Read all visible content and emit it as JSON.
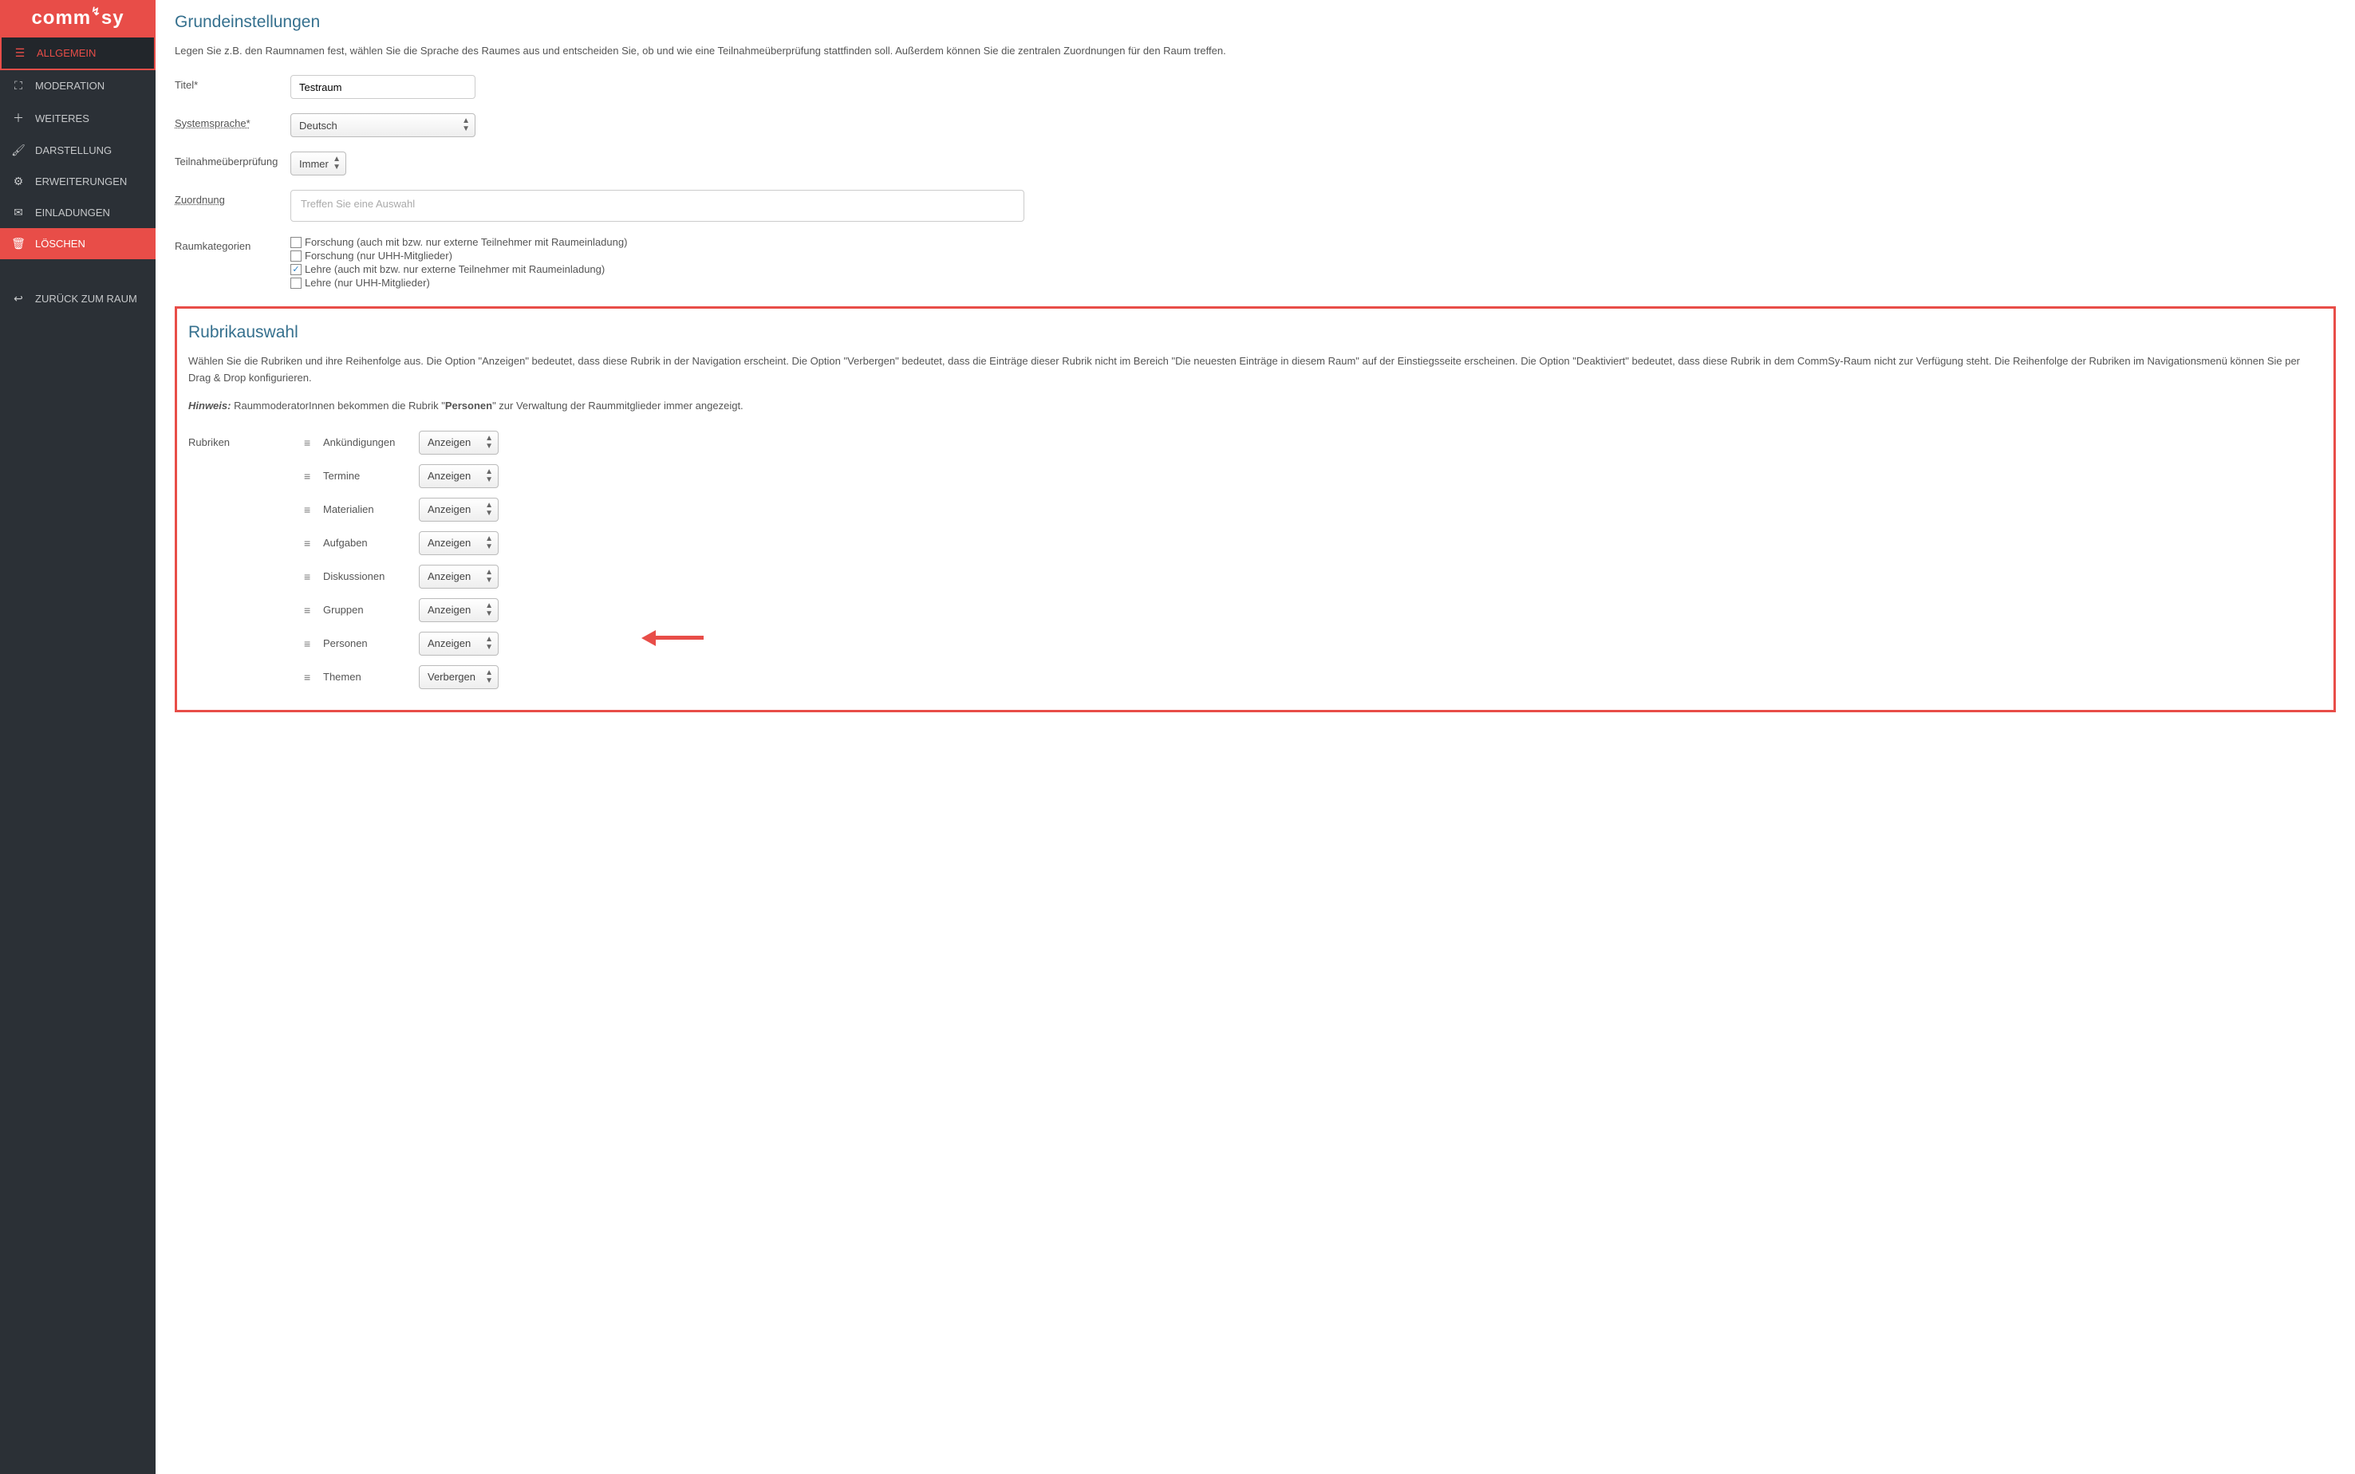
{
  "brand": "commsy",
  "sidebar": {
    "items": [
      {
        "label": "ALLGEMEIN",
        "icon": "server-icon",
        "active": true
      },
      {
        "label": "MODERATION",
        "icon": "sitemap-icon"
      },
      {
        "label": "WEITERES",
        "icon": "plus-icon"
      },
      {
        "label": "DARSTELLUNG",
        "icon": "brush-icon"
      },
      {
        "label": "ERWEITERUNGEN",
        "icon": "gears-icon"
      },
      {
        "label": "EINLADUNGEN",
        "icon": "envelope-icon"
      },
      {
        "label": "LÖSCHEN",
        "icon": "trash-icon",
        "delete": true
      }
    ],
    "back": {
      "label": "ZURÜCK ZUM RAUM",
      "icon": "reply-icon"
    }
  },
  "section1": {
    "title": "Grundeinstellungen",
    "description": "Legen Sie z.B. den Raumnamen fest, wählen Sie die Sprache des Raumes aus und entscheiden Sie, ob und wie eine Teilnahmeüberprüfung stattfinden soll. Außerdem können Sie die zentralen Zuordnungen für den Raum treffen.",
    "labels": {
      "title": "Titel*",
      "language": "Systemsprache*",
      "participation": "Teilnahmeüberprüfung",
      "assignment": "Zuordnung",
      "categories": "Raumkategorien"
    },
    "values": {
      "title": "Testraum",
      "language": "Deutsch",
      "participation": "Immer",
      "assignment_placeholder": "Treffen Sie eine Auswahl"
    },
    "categories": [
      {
        "label": "Forschung (auch mit bzw. nur externe Teilnehmer mit Raumeinladung)",
        "checked": false
      },
      {
        "label": "Forschung (nur UHH-Mitglieder)",
        "checked": false
      },
      {
        "label": "Lehre (auch mit bzw. nur externe Teilnehmer mit Raumeinladung)",
        "checked": true
      },
      {
        "label": "Lehre (nur UHH-Mitglieder)",
        "checked": false
      }
    ]
  },
  "section2": {
    "title": "Rubrikauswahl",
    "description": "Wählen Sie die Rubriken und ihre Reihenfolge aus. Die Option \"Anzeigen\" bedeutet, dass diese Rubrik in der Navigation erscheint. Die Option \"Verbergen\" bedeutet, dass die Einträge dieser Rubrik nicht im Bereich \"Die neuesten Einträge in diesem Raum\" auf der Einstiegsseite erscheinen. Die Option \"Deaktiviert\" bedeutet, dass diese Rubrik in dem CommSy-Raum nicht zur Verfügung steht. Die Reihenfolge der Rubriken im Navigationsmenü können Sie per Drag & Drop konfigurieren.",
    "hint_label": "Hinweis:",
    "hint_pre": " RaummoderatorInnen bekommen die Rubrik \"",
    "hint_bold": "Personen",
    "hint_post": "\" zur Verwaltung der Raummitglieder immer angezeigt.",
    "rubriken_label": "Rubriken",
    "rubriken": [
      {
        "name": "Ankündigungen",
        "value": "Anzeigen"
      },
      {
        "name": "Termine",
        "value": "Anzeigen"
      },
      {
        "name": "Materialien",
        "value": "Anzeigen"
      },
      {
        "name": "Aufgaben",
        "value": "Anzeigen"
      },
      {
        "name": "Diskussionen",
        "value": "Anzeigen"
      },
      {
        "name": "Gruppen",
        "value": "Anzeigen"
      },
      {
        "name": "Personen",
        "value": "Anzeigen"
      },
      {
        "name": "Themen",
        "value": "Verbergen"
      }
    ]
  }
}
